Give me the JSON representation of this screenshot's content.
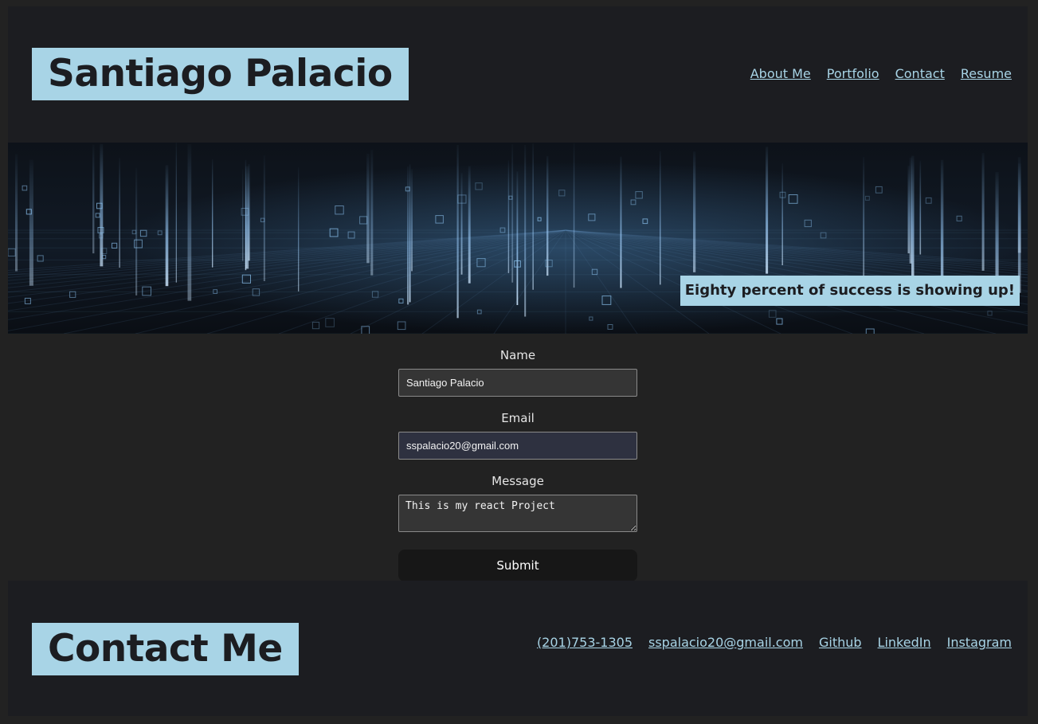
{
  "header": {
    "brand": "Santiago Palacio",
    "nav": [
      {
        "label": "About Me"
      },
      {
        "label": "Portfolio"
      },
      {
        "label": "Contact"
      },
      {
        "label": "Resume"
      }
    ]
  },
  "hero": {
    "quote": "Eighty percent of success is showing up!"
  },
  "form": {
    "name_label": "Name",
    "name_value": "Santiago Palacio",
    "email_label": "Email",
    "email_value": "sspalacio20@gmail.com",
    "message_label": "Message",
    "message_value": "This is my react Project",
    "submit_label": "Submit"
  },
  "footer": {
    "title": "Contact Me",
    "links": [
      {
        "label": "(201)753-1305"
      },
      {
        "label": "sspalacio20@gmail.com"
      },
      {
        "label": "Github"
      },
      {
        "label": "LinkedIn"
      },
      {
        "label": "Instagram"
      }
    ]
  },
  "colors": {
    "accent": "#a8d4e6",
    "header_bg": "#1c1d21",
    "page_bg": "#222222"
  }
}
